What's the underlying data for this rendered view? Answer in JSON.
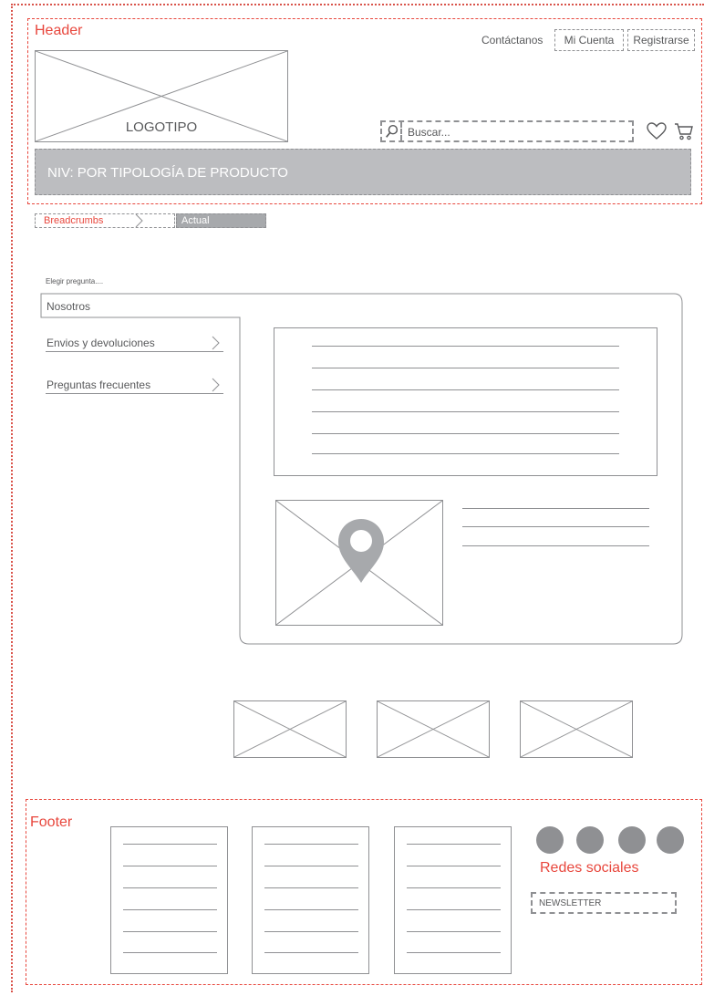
{
  "header": {
    "section_label": "Header",
    "logo_text": "LOGOTIPO",
    "nav": {
      "contact": "Contáctanos",
      "account": "Mi Cuenta",
      "register": "Registrarse"
    },
    "search": {
      "placeholder": "Buscar..."
    },
    "nav_bar_text": "NIV: POR TIPOLOGÍA DE PRODUCTO"
  },
  "breadcrumbs": {
    "link": "Breadcrumbs",
    "current": "Actual"
  },
  "content": {
    "question_label": "Elegir pregunta....",
    "active_tab": "Nosotros",
    "menu": [
      {
        "label": "Envios y devoluciones"
      },
      {
        "label": "Preguntas frecuentes"
      }
    ]
  },
  "footer": {
    "section_label": "Footer",
    "social_label": "Redes sociales",
    "newsletter": "NEWSLETTER"
  },
  "colors": {
    "annotation": "#e8473d",
    "wire_gray": "#8f9093",
    "nav_bar_bg": "#bcbdc0"
  },
  "icons": [
    "search-icon",
    "heart-icon",
    "cart-icon",
    "chevron-right-icon",
    "map-pin-icon"
  ]
}
